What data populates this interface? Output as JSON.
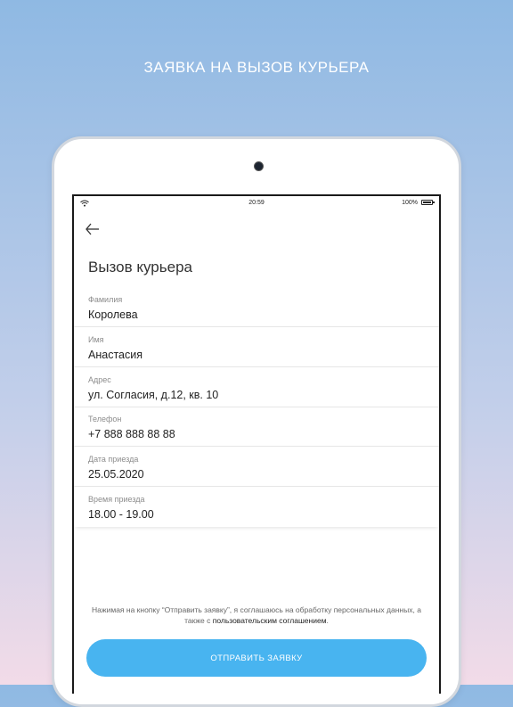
{
  "headline": "ЗАЯВКА НА ВЫЗОВ КУРЬЕРА",
  "status_bar": {
    "time": "20:59",
    "battery": "100%",
    "wifi_icon": "wifi-icon",
    "battery_icon": "battery-icon",
    "battery_level": 1.0
  },
  "header": {
    "back_icon": "arrow-left-icon",
    "title": "Вызов курьера"
  },
  "fields": [
    {
      "label": "Фамилия",
      "value": "Королева"
    },
    {
      "label": "Имя",
      "value": "Анастасия"
    },
    {
      "label": "Адрес",
      "value": "ул. Согласия, д.12, кв. 10"
    },
    {
      "label": "Телефон",
      "value": "+7 888 888 88 88"
    },
    {
      "label": "Дата приезда",
      "value": "25.05.2020"
    },
    {
      "label": "Время приезда",
      "value": "18.00 - 19.00"
    }
  ],
  "consent": {
    "text_before": "Нажимая на кнопку “Отправить заявку”, я соглашаюсь на обработку персональных данных, а также с",
    "link": "пользовательским соглашением",
    "text_after": "."
  },
  "submit_label": "ОТПРАВИТЬ ЗАЯВКУ",
  "colors": {
    "accent": "#48b4f0",
    "bg_top": "#8fb9e3",
    "bg_bottom": "#f2dbe8"
  }
}
